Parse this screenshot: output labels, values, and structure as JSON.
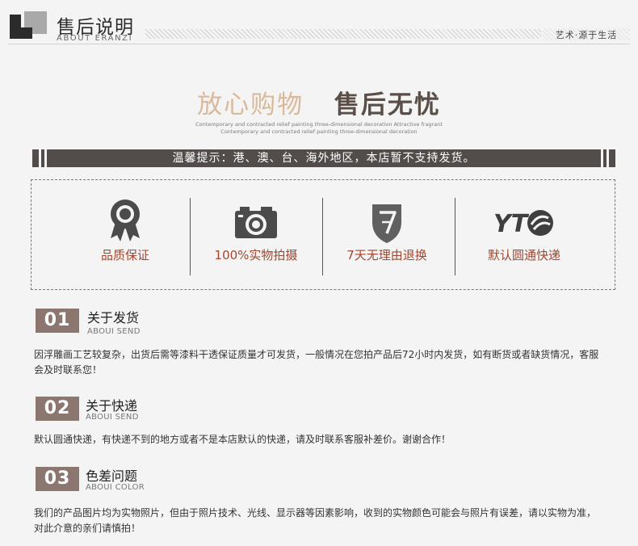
{
  "header": {
    "title": "售后说明",
    "subtitle": "ABOUT ERANZI",
    "tagline": "艺术·源于生活"
  },
  "hero": {
    "title_part1": "放心购物",
    "title_part2": "售后无忧",
    "en_line1": "Contemporary and contracted relief painting three-dimensional decoration Attractive fragrant",
    "en_line2": "Contemporary and contracted relief painting three-dimensional decoration"
  },
  "notice": {
    "text": "温馨提示：港、澳、台、海外地区，本店暂不支持发货。"
  },
  "guarantees": [
    {
      "icon": "award-ribbon-icon",
      "label": "品质保证"
    },
    {
      "icon": "camera-icon",
      "label": "100%实物拍摄"
    },
    {
      "icon": "shield-7-icon",
      "label": "7天无理由退换"
    },
    {
      "icon": "yto-express-logo-icon",
      "label": "默认圆通快递",
      "logo_text": "YT"
    }
  ],
  "sections": [
    {
      "number": "01",
      "title": "关于发货",
      "subtitle": "ABOUI SEND",
      "text": "因浮雕画工艺较复杂，出货后需等漆料干透保证质量才可发货，一般情况在您拍产品后72小时内发货，如有断货或者缺货情况，客服会及时联系您！"
    },
    {
      "number": "02",
      "title": "关于快递",
      "subtitle": "ABOUI SEND",
      "text": "默认圆通快递，有快递不到的地方或者不是本店默认的快递，请及时联系客服补差价。谢谢合作！"
    },
    {
      "number": "03",
      "title": "色差问题",
      "subtitle": "ABOUI COLOR",
      "text": "我们的产品图片均为实物照片，但由于照片技术、光线、显示器等因素影响，收到的实物颜色可能会与照片有误差，请以实物为准，对此介意的亲们请慎拍！"
    }
  ],
  "colors": {
    "accent_dark": "#524c4a",
    "hero_light": "#d9b99a",
    "label_red": "#a0472f",
    "number_badge": "#8b7670"
  }
}
